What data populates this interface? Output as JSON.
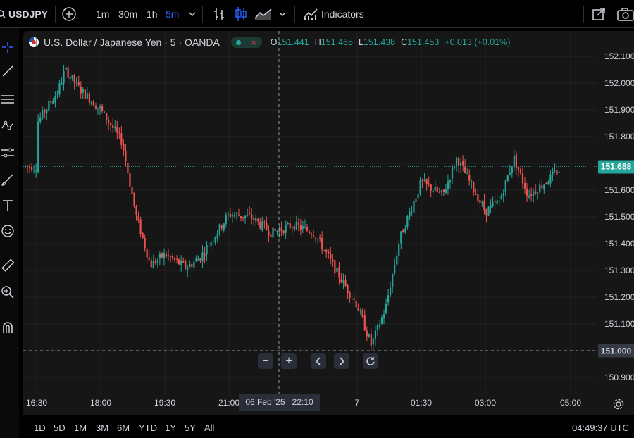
{
  "toolbar": {
    "symbol": "USDJPY",
    "add_icon": "plus-circle-icon",
    "intervals": [
      "1m",
      "30m",
      "1h",
      "5m"
    ],
    "active_interval": "5m",
    "indicators_label": "Indicators"
  },
  "header": {
    "title": "U.S. Dollar / Japanese Yen · 5 · OANDA",
    "ohlc": [
      {
        "key": "O",
        "value": "151.441"
      },
      {
        "key": "H",
        "value": "151.465"
      },
      {
        "key": "L",
        "value": "151.438"
      },
      {
        "key": "C",
        "value": "151.453"
      }
    ],
    "change": "+0.013 (+0.01%)"
  },
  "price_labels": {
    "last": "151.688",
    "last_color": "#26a69a",
    "crosshair": "151.000"
  },
  "crosshair_time": {
    "date": "06 Feb '25",
    "time": "22:10"
  },
  "range_buttons": [
    "1D",
    "5D",
    "1M",
    "3M",
    "6M",
    "YTD",
    "1Y",
    "5Y",
    "All"
  ],
  "clock": "04:49:37 UTC",
  "colors": {
    "up": "#26a69a",
    "down": "#ef5350",
    "accent": "#2962ff"
  },
  "chart_data": {
    "type": "candlestick",
    "y_ticks": [
      "152.100",
      "152.000",
      "151.900",
      "151.800",
      "151.700",
      "151.600",
      "151.500",
      "151.400",
      "151.300",
      "151.200",
      "151.100",
      "151.000",
      "150.900"
    ],
    "x_ticks": [
      "16:30",
      "18:00",
      "19:30",
      "21:00",
      "7",
      "01:30",
      "03:00",
      "05:00"
    ],
    "ylim": [
      150.87,
      152.13
    ],
    "grid": true,
    "approx_close_path": [
      [
        "16:30",
        151.85
      ],
      [
        "17:00",
        151.97
      ],
      [
        "17:10",
        152.05
      ],
      [
        "17:30",
        151.98
      ],
      [
        "18:00",
        151.9
      ],
      [
        "18:30",
        151.78
      ],
      [
        "18:50",
        151.5
      ],
      [
        "19:10",
        151.32
      ],
      [
        "19:30",
        151.36
      ],
      [
        "20:00",
        151.31
      ],
      [
        "20:20",
        151.35
      ],
      [
        "20:40",
        151.43
      ],
      [
        "21:00",
        151.51
      ],
      [
        "21:30",
        151.5
      ],
      [
        "22:00",
        151.44
      ],
      [
        "22:30",
        151.47
      ],
      [
        "23:00",
        151.44
      ],
      [
        "23:30",
        151.3
      ],
      [
        "00:00",
        151.17
      ],
      [
        "00:20",
        151.02
      ],
      [
        "00:40",
        151.16
      ],
      [
        "01:00",
        151.42
      ],
      [
        "01:30",
        151.63
      ],
      [
        "02:00",
        151.58
      ],
      [
        "02:20",
        151.72
      ],
      [
        "02:40",
        151.62
      ],
      [
        "03:00",
        151.52
      ],
      [
        "03:20",
        151.56
      ],
      [
        "03:40",
        151.72
      ],
      [
        "04:00",
        151.58
      ],
      [
        "04:20",
        151.62
      ],
      [
        "04:49",
        151.688
      ]
    ]
  }
}
